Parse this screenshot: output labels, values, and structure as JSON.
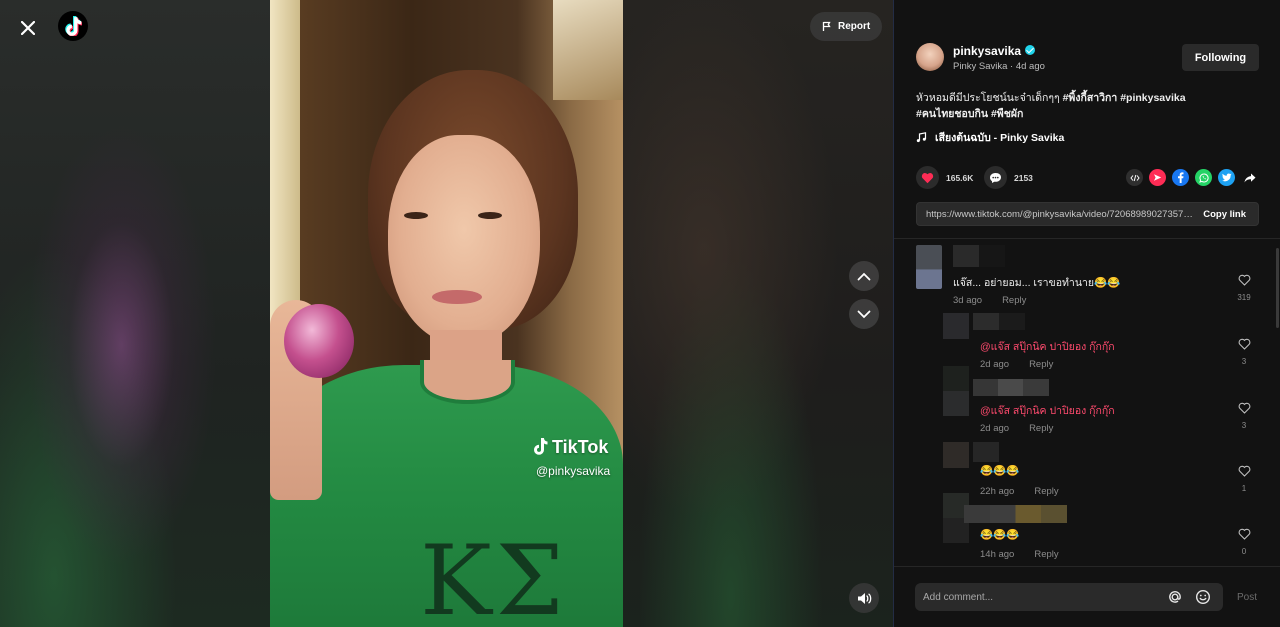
{
  "player": {
    "report_label": "Report",
    "watermark_brand": "TikTok",
    "watermark_handle": "@pinkysavika",
    "shirt_letters": "ΚΣ"
  },
  "author": {
    "username": "pinkysavika",
    "display_name": "Pinky Savika",
    "posted_ago": "4d ago",
    "separator": "·",
    "follow_label": "Following"
  },
  "description": {
    "text": "หัวหอมดีมีประโยชน์นะจ๋าเด็กๆๆ ",
    "tags": [
      "#พิ้งกี้สาวิกา",
      "#pinkysavika",
      "#คนไทยชอบกิน",
      "#พืชผัก"
    ]
  },
  "music": {
    "title": "เสียงต้นฉบับ - Pinky Savika"
  },
  "stats": {
    "likes": "165.6K",
    "comments": "2153"
  },
  "share_link": {
    "url": "https://www.tiktok.com/@pinkysavika/video/7206898902735768325",
    "copy_label": "Copy link"
  },
  "comments": [
    {
      "text": "แจ๊ส... อย่ายอม... เราขอทำนาย😂😂",
      "ago": "3d ago",
      "reply_label": "Reply",
      "likes": "319",
      "mention": false
    },
    {
      "text": "@แจ๊ส สปุ๊กนิค ปาปิยอง กุ๊กกุ๊ก",
      "ago": "2d ago",
      "reply_label": "Reply",
      "likes": "3",
      "mention": true
    },
    {
      "text": "@แจ๊ส สปุ๊กนิค ปาปิยอง กุ๊กกุ๊ก",
      "ago": "2d ago",
      "reply_label": "Reply",
      "likes": "3",
      "mention": true
    },
    {
      "text": "😂😂😂",
      "ago": "22h ago",
      "reply_label": "Reply",
      "likes": "1",
      "mention": false
    },
    {
      "text": "😂😂😂",
      "ago": "14h ago",
      "reply_label": "Reply",
      "likes": "0",
      "mention": false
    }
  ],
  "composer": {
    "placeholder": "Add comment...",
    "post_label": "Post"
  },
  "colors": {
    "like_red": "#fe2c55",
    "mention_red": "#ff4b6e",
    "verified_blue": "#20d5ec",
    "panel_bg": "#121212"
  }
}
